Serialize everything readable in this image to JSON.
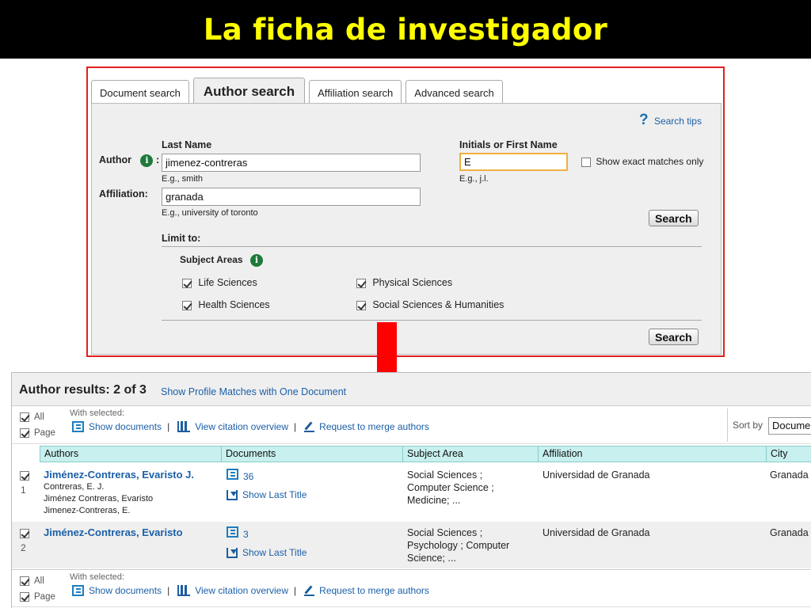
{
  "slide_title": "La ficha de investigador",
  "search": {
    "tabs": [
      "Document search",
      "Author search",
      "Affiliation search",
      "Advanced search"
    ],
    "search_tips": "Search tips",
    "author_label": "Author",
    "colon": ":",
    "affiliation_label": "Affiliation:",
    "last_name_label": "Last Name",
    "last_name_value": "jimenez-contreras",
    "last_name_hint": "E.g., smith",
    "affiliation_value": "granada",
    "affiliation_hint": "E.g., university of toronto",
    "first_name_label": "Initials or First Name",
    "first_name_value": "E",
    "first_name_hint": "E.g., j.l.",
    "exact_match_label": "Show exact matches only",
    "search_button": "Search",
    "limit_to": "Limit to:",
    "subject_areas_label": "Subject Areas",
    "subject_areas": [
      "Life Sciences",
      "Physical Sciences",
      "Health Sciences",
      "Social Sciences & Humanities"
    ]
  },
  "results": {
    "title": "Author results: 2 of 3",
    "profile_matches_link": "Show Profile Matches with One Document",
    "all_label": "All",
    "page_label": "Page",
    "with_selected": "With selected:",
    "show_documents": "Show documents",
    "view_citation": "View citation overview",
    "merge_authors": "Request to merge authors",
    "separator": "|",
    "sort_by_label": "Sort by",
    "sort_by_value": "Documents",
    "columns": [
      "Authors",
      "Documents",
      "Subject Area",
      "Affiliation",
      "City"
    ],
    "show_last_title": "Show Last Title",
    "rows": [
      {
        "num": "1",
        "name": "Jiménez-Contreras, Evaristo J.",
        "variants": [
          "Contreras, E. J.",
          "Jiménez Contreras, Evaristo",
          "Jimenez-Contreras, E."
        ],
        "documents": "36",
        "subject": [
          "Social Sciences ;",
          "Computer Science ;",
          "Medicine; ..."
        ],
        "affiliation": "Universidad de Granada",
        "city": "Granada"
      },
      {
        "num": "2",
        "name": "Jiménez-Contreras, Evaristo",
        "variants": [],
        "documents": "3",
        "subject": [
          "Social Sciences ;",
          "Psychology ; Computer",
          "Science; ..."
        ],
        "affiliation": "Universidad de Granada",
        "city": "Granada"
      }
    ]
  },
  "colors": {
    "title_bg": "#000000",
    "title_text": "#ffff00",
    "frame_border": "#e02020",
    "arrow": "#ff0000",
    "link": "#1b5fa8",
    "column_header": "#c8f0ee"
  }
}
